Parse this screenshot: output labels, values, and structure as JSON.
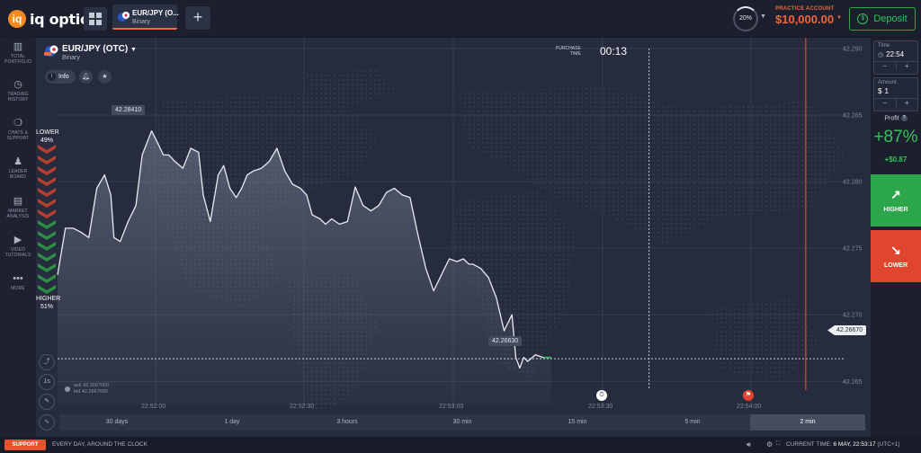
{
  "topbar": {
    "brand": "iq option",
    "asset_tab": {
      "name": "EUR/JPY (O...",
      "type": "Binary"
    },
    "plus_label": "+",
    "payout_circle": "20%",
    "account": {
      "label": "PRACTICE ACCOUNT",
      "balance": "$10,000.00"
    },
    "deposit_label": "Deposit"
  },
  "sidebar": {
    "items": [
      {
        "icon": "portfolio-icon",
        "label": "TOTAL PORTFOLIO"
      },
      {
        "icon": "history-icon",
        "label": "TRADING HISTORY"
      },
      {
        "icon": "chat-icon",
        "label": "CHATS & SUPPORT"
      },
      {
        "icon": "leaderboard-icon",
        "label": "LEADER BOARD"
      },
      {
        "icon": "analysis-icon",
        "label": "MARKET ANALYSIS"
      },
      {
        "icon": "video-icon",
        "label": "VIDEO TUTORIALS"
      },
      {
        "icon": "more-icon",
        "label": "MORE"
      }
    ]
  },
  "chart": {
    "asset_title": "EUR/JPY (OTC)",
    "asset_type": "Binary",
    "info_label": "Info",
    "lower": {
      "label": "LOWER",
      "pct": "49%"
    },
    "higher": {
      "label": "HIGHER",
      "pct": "51%"
    },
    "purchase_label_1": "PURCHASE",
    "purchase_label_2": "TIME",
    "timer": "00:13",
    "max_tag": "42.28410",
    "min_tag": "42.26630",
    "current_tag": "42.26670",
    "ask": "ask 42.2667000",
    "bid": "bid 42.2667000",
    "interval_label": "1s",
    "periods": [
      "30 days",
      "1 day",
      "3 hours",
      "30 min",
      "15 min",
      "5 min",
      "2 min"
    ],
    "active_period": "2 min"
  },
  "chart_data": {
    "type": "line",
    "y_ticks": [
      "42.290",
      "42.285",
      "42.280",
      "42.275",
      "42.270",
      "42.265"
    ],
    "x_ticks": [
      "22:52:00",
      "22:52:30",
      "22:53:00",
      "22:53:30",
      "22:54:00"
    ],
    "ylim": [
      42.2632,
      42.2908
    ],
    "xlim": [
      0,
      100
    ],
    "series": [
      {
        "x": [
          0,
          1,
          2,
          3,
          4,
          5,
          6,
          6.8,
          7.2,
          8,
          9,
          10,
          10.8,
          12,
          12.7,
          13.5,
          14.2,
          15,
          16,
          17,
          18,
          18.6,
          19.5,
          20.5,
          21.2,
          22,
          22.8,
          23.5,
          24.2,
          25,
          26,
          27,
          28,
          29,
          30,
          31,
          31.8,
          32.5,
          33.5,
          34.2,
          35,
          36,
          37,
          38,
          39,
          40,
          41,
          42,
          43,
          44,
          45,
          46,
          47,
          48,
          49,
          50,
          51,
          51.8,
          52.5,
          53,
          54,
          55,
          56,
          57,
          58,
          58.5,
          59,
          59.5,
          60,
          61,
          62,
          63
        ],
        "y": [
          42.273,
          42.2765,
          42.2765,
          42.2762,
          42.2758,
          42.2795,
          42.2805,
          42.279,
          42.2758,
          42.2755,
          42.277,
          42.2782,
          42.282,
          42.2838,
          42.283,
          42.282,
          42.282,
          42.2815,
          42.281,
          42.2825,
          42.2822,
          42.279,
          42.277,
          42.2805,
          42.2812,
          42.2795,
          42.2788,
          42.2795,
          42.2805,
          42.2808,
          42.281,
          42.2815,
          42.2825,
          42.2808,
          42.2798,
          42.2795,
          42.279,
          42.2775,
          42.2772,
          42.2768,
          42.2772,
          42.2768,
          42.277,
          42.2796,
          42.2782,
          42.2778,
          42.2782,
          42.2792,
          42.2795,
          42.279,
          42.2788,
          42.276,
          42.2735,
          42.2718,
          42.273,
          42.2742,
          42.274,
          42.2742,
          42.2738,
          42.2738,
          42.2735,
          42.2728,
          42.2713,
          42.2688,
          42.27,
          42.2668,
          42.266,
          42.2668,
          42.2665,
          42.267,
          42.2668,
          42.2668
        ]
      }
    ],
    "current_price": 42.2667,
    "purchase_time_x": 75.5,
    "expiration_x": 95.5,
    "grid": true
  },
  "rpanel": {
    "time": {
      "label": "Time",
      "value": "22:54",
      "minus": "−",
      "plus": "+"
    },
    "amount": {
      "label": "Amount",
      "currency": "$",
      "value": "1",
      "minus": "−",
      "plus": "+"
    },
    "profit_label": "Profit",
    "profit_pct": "+87%",
    "profit_usd": "+$0.87",
    "higher_label": "HIGHER",
    "lower_label": "LOWER"
  },
  "footer": {
    "support_label": "SUPPORT",
    "tagline": "EVERY DAY, AROUND THE CLOCK",
    "current_time_label": "CURRENT TIME:",
    "current_time_value": "6 MAY, 22:53:17",
    "timezone": "(UTC+1)"
  },
  "colors": {
    "up": "#36c35a",
    "down": "#e0462e",
    "accent": "#f1663a",
    "bg": "#262b3d"
  }
}
